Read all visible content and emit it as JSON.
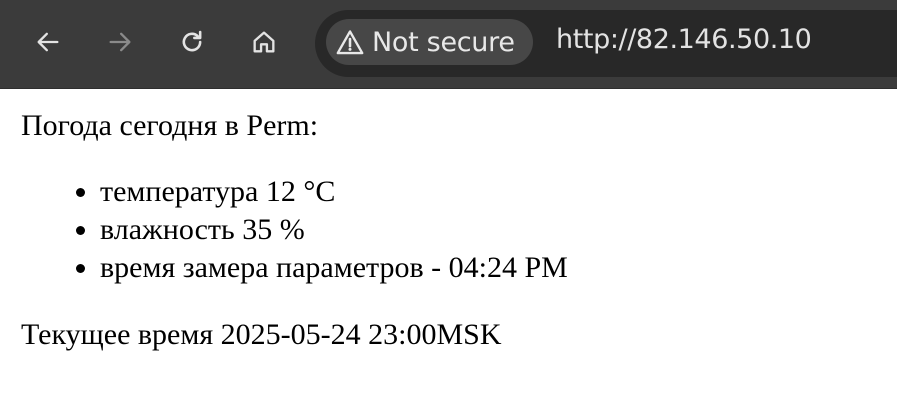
{
  "browser": {
    "icons": {
      "back": "arrow-left-icon",
      "forward": "arrow-right-icon",
      "reload": "reload-icon",
      "home": "home-icon",
      "security": "warning-triangle-icon"
    },
    "security_label": "Not secure",
    "url": "http://82.146.50.10",
    "colors": {
      "toolbar_bg": "#3b3b3b",
      "omnibox_bg": "#282828",
      "chip_bg": "#474747",
      "icon_active": "#e3e3e3",
      "icon_disabled": "#8a8a8a"
    }
  },
  "page": {
    "heading": "Погода сегодня в Perm:",
    "items": [
      "температура 12 °C",
      "влажность 35 %",
      "время замера параметров - 04:24 PM"
    ],
    "current_time": "Текущее время 2025-05-24 23:00MSK"
  }
}
